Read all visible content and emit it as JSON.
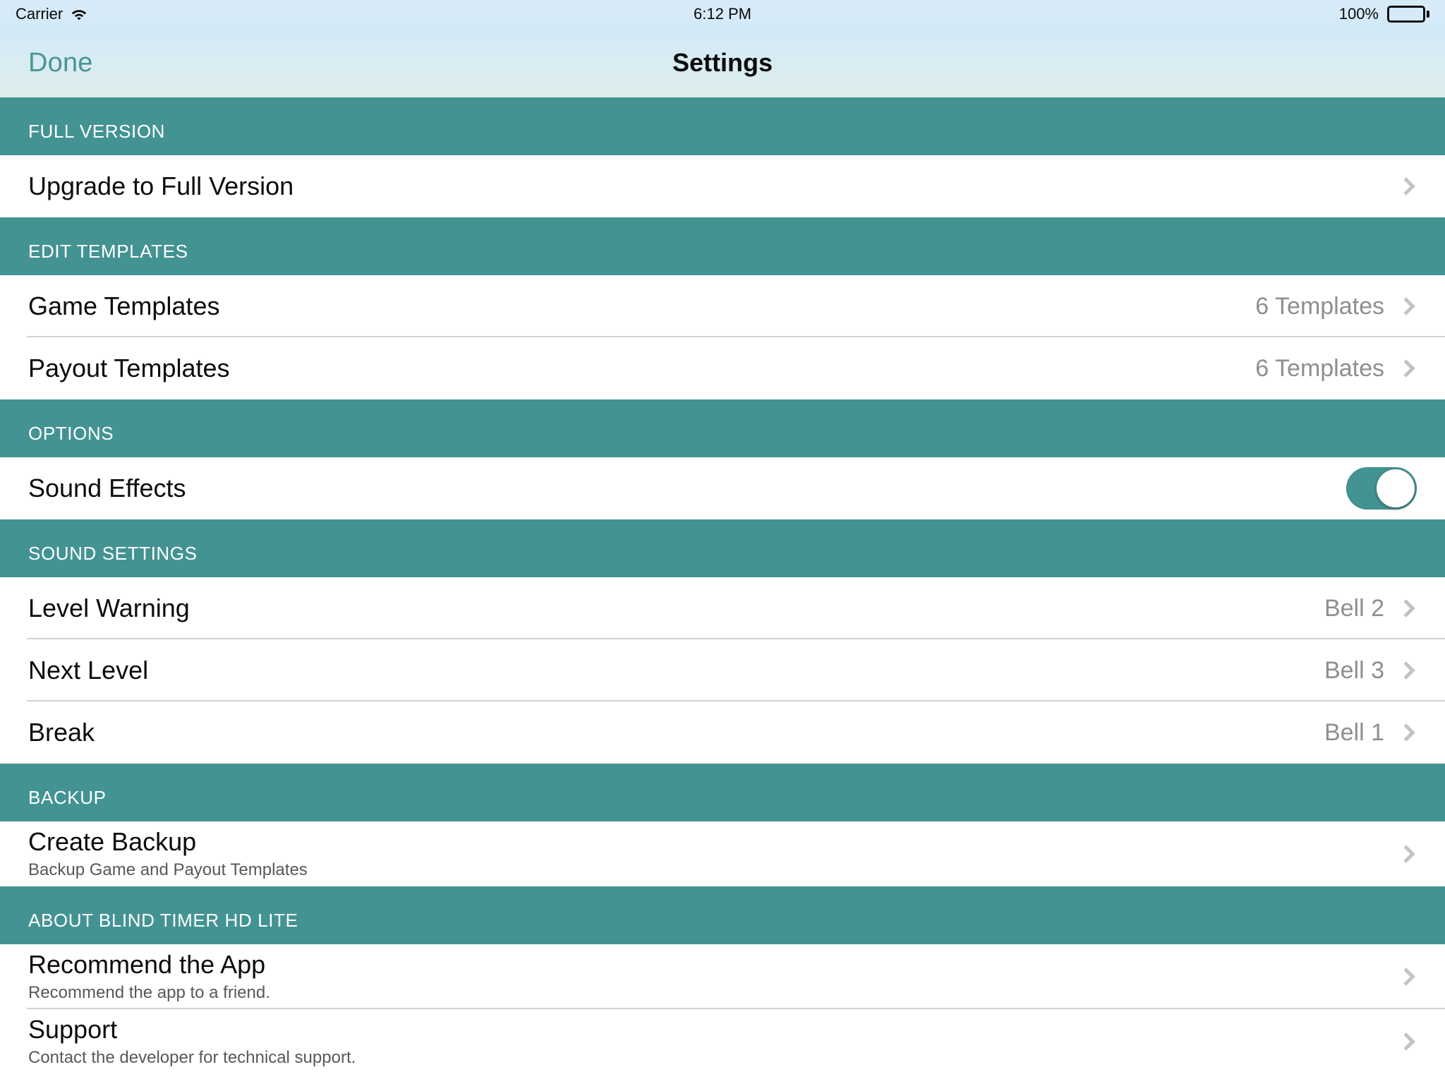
{
  "status_bar": {
    "carrier": "Carrier",
    "wifi_icon": "wifi-icon",
    "time": "6:12 PM",
    "battery_percent": "100%",
    "battery_icon": "battery-full-icon"
  },
  "nav_bar": {
    "done_label": "Done",
    "title": "Settings"
  },
  "colors": {
    "section_header_bg": "#449393",
    "accent_teal": "#4a9595",
    "toggle_on": "#449393",
    "detail_gray": "#8e8e93",
    "chevron_gray": "#c2c2c7"
  },
  "sections": [
    {
      "header": "FULL VERSION",
      "rows": [
        {
          "title": "Upgrade to Full Version",
          "subtitle": "",
          "detail": "",
          "accessory": "chevron"
        }
      ]
    },
    {
      "header": "EDIT TEMPLATES",
      "rows": [
        {
          "title": "Game Templates",
          "subtitle": "",
          "detail": "6 Templates",
          "accessory": "chevron"
        },
        {
          "title": "Payout Templates",
          "subtitle": "",
          "detail": "6 Templates",
          "accessory": "chevron"
        }
      ]
    },
    {
      "header": "OPTIONS",
      "rows": [
        {
          "title": "Sound Effects",
          "subtitle": "",
          "detail": "",
          "accessory": "toggle",
          "toggle_on": true
        }
      ]
    },
    {
      "header": "SOUND SETTINGS",
      "rows": [
        {
          "title": "Level Warning",
          "subtitle": "",
          "detail": "Bell 2",
          "accessory": "chevron"
        },
        {
          "title": "Next Level",
          "subtitle": "",
          "detail": "Bell 3",
          "accessory": "chevron"
        },
        {
          "title": "Break",
          "subtitle": "",
          "detail": "Bell 1",
          "accessory": "chevron"
        }
      ]
    },
    {
      "header": "BACKUP",
      "rows": [
        {
          "title": "Create Backup",
          "subtitle": "Backup Game and Payout Templates",
          "detail": "",
          "accessory": "chevron"
        }
      ]
    },
    {
      "header": "ABOUT BLIND TIMER HD LITE",
      "rows": [
        {
          "title": "Recommend the App",
          "subtitle": "Recommend the app to a friend.",
          "detail": "",
          "accessory": "chevron"
        },
        {
          "title": "Support",
          "subtitle": "Contact the developer for technical support.",
          "detail": "",
          "accessory": "chevron"
        }
      ]
    }
  ]
}
